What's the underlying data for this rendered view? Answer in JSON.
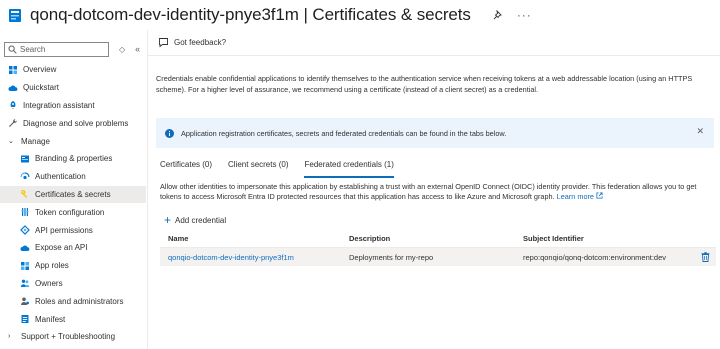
{
  "header": {
    "title": "qonq-dotcom-dev-identity-pnye3f1m | Certificates & secrets",
    "more": "···"
  },
  "sidebar": {
    "search_placeholder": "Search",
    "collapse_all": "«",
    "collapse_toggle": "◇",
    "items": [
      {
        "label": "Overview",
        "icon": "grid-icon"
      },
      {
        "label": "Quickstart",
        "icon": "cloud-icon"
      },
      {
        "label": "Integration assistant",
        "icon": "rocket-icon"
      },
      {
        "label": "Diagnose and solve problems",
        "icon": "wrench-icon"
      },
      {
        "label": "Manage",
        "icon": "chevron-down-icon"
      },
      {
        "label": "Branding & properties",
        "icon": "branding-icon"
      },
      {
        "label": "Authentication",
        "icon": "authentication-icon"
      },
      {
        "label": "Certificates & secrets",
        "icon": "key-icon"
      },
      {
        "label": "Token configuration",
        "icon": "token-icon"
      },
      {
        "label": "API permissions",
        "icon": "api-permissions-icon"
      },
      {
        "label": "Expose an API",
        "icon": "cloud-icon"
      },
      {
        "label": "App roles",
        "icon": "app-roles-icon"
      },
      {
        "label": "Owners",
        "icon": "owners-icon"
      },
      {
        "label": "Roles and administrators",
        "icon": "roles-icon"
      },
      {
        "label": "Manifest",
        "icon": "manifest-icon"
      },
      {
        "label": "Support + Troubleshooting",
        "icon": "chevron-right-icon"
      }
    ]
  },
  "toolbar": {
    "feedback_label": "Got feedback?"
  },
  "main": {
    "intro": "Credentials enable confidential applications to identify themselves to the authentication service when receiving tokens at a web addressable location (using an HTTPS scheme). For a higher level of assurance, we recommend using a certificate (instead of a client secret) as a credential.",
    "banner": "Application registration certificates, secrets and federated credentials can be found in the tabs below.",
    "banner_close": "✕",
    "tabs": [
      {
        "label": "Certificates (0)"
      },
      {
        "label": "Client secrets (0)"
      },
      {
        "label": "Federated credentials (1)"
      }
    ],
    "description": "Allow other identities to impersonate this application by establishing a trust with an external OpenID Connect (OIDC) identity provider. This federation allows you to get tokens to access Microsoft Entra ID protected resources that this application has access to like Azure and Microsoft graph.",
    "learn_more": "Learn more",
    "add_credential": "Add credential",
    "add_plus": "+",
    "table": {
      "headers": [
        "Name",
        "Description",
        "Subject Identifier"
      ],
      "rows": [
        [
          "qonqio-dotcom-dev-identity-pnye3f1m",
          "Deployments for my-repo",
          "repo:qonqio/qonq-dotcom:environment:dev"
        ]
      ]
    }
  },
  "colors": {
    "accent": "#0f6cbd",
    "banner_bg": "#ebf3fc",
    "active_item_bg": "#edebe9"
  }
}
